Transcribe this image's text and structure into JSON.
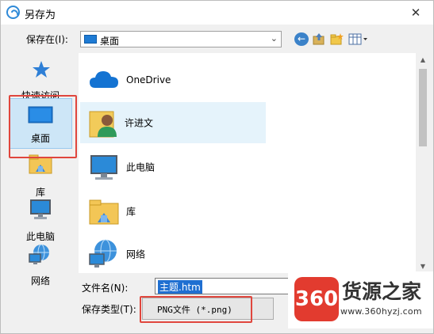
{
  "window": {
    "title": "另存为",
    "close_glyph": "✕"
  },
  "address": {
    "label": "保存在(I):",
    "value": "桌面",
    "dropdown_glyph": "⌄"
  },
  "nav": {
    "items": [
      {
        "label": "快速访问",
        "icon": "star-icon"
      },
      {
        "label": "桌面",
        "icon": "desktop-icon",
        "selected": true
      },
      {
        "label": "库",
        "icon": "library-icon"
      },
      {
        "label": "此电脑",
        "icon": "computer-icon"
      },
      {
        "label": "网络",
        "icon": "network-icon"
      }
    ]
  },
  "files": [
    {
      "name": "OneDrive",
      "icon": "cloud-icon"
    },
    {
      "name": "许进文",
      "icon": "user-folder-icon"
    },
    {
      "name": "此电脑",
      "icon": "computer-icon"
    },
    {
      "name": "库",
      "icon": "library-icon"
    },
    {
      "name": "网络",
      "icon": "network-icon"
    }
  ],
  "form": {
    "filename_label": "文件名(N):",
    "filename_value": "主题.htm",
    "filetype_label": "保存类型(T):",
    "filetype_value": "PNG文件 (*.png)"
  },
  "watermark": {
    "badge": "360",
    "name": "货源之家",
    "url": "www.360hyzj.com"
  },
  "colors": {
    "accent": "#1e7bd4",
    "highlight_box": "#e0463d",
    "selection": "#cde6f7"
  }
}
